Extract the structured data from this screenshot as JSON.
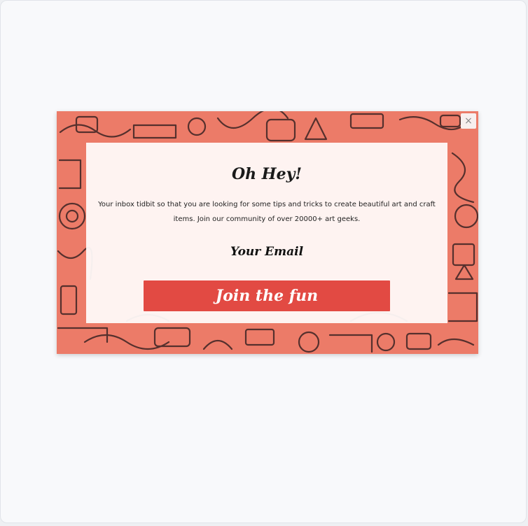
{
  "popup": {
    "close_label": "×",
    "title": "Oh Hey!",
    "description": "Your inbox tidbit so that you are looking for some tips and tricks to create beautiful art and craft items. Join our community of over 20000+ art geeks.",
    "email_label": "Your Email",
    "submit_label": "Join the fun",
    "background_color": "#ec7b68",
    "button_color": "#e24a43"
  }
}
